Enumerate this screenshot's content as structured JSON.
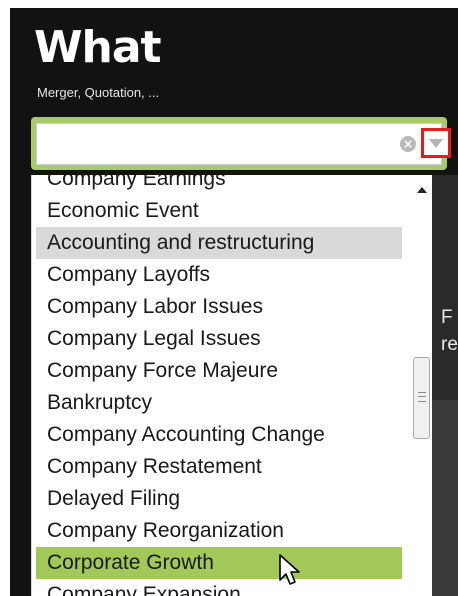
{
  "header": {
    "title": "What",
    "subtitle": "Merger, Quotation, ..."
  },
  "search": {
    "value": "",
    "placeholder": ""
  },
  "dropdown": {
    "items": [
      {
        "label": "Company Earnings"
      },
      {
        "label": "Economic Event"
      },
      {
        "label": "Accounting and restructuring",
        "state": "hover"
      },
      {
        "label": "Company Layoffs"
      },
      {
        "label": "Company Labor Issues"
      },
      {
        "label": "Company Legal Issues"
      },
      {
        "label": "Company Force Majeure"
      },
      {
        "label": "Bankruptcy"
      },
      {
        "label": "Company Accounting Change"
      },
      {
        "label": "Company Restatement"
      },
      {
        "label": "Delayed Filing"
      },
      {
        "label": "Company Reorganization"
      },
      {
        "label": "Corporate Growth",
        "state": "selected"
      },
      {
        "label": "Company Expansion"
      }
    ]
  },
  "background": {
    "partial_text": "F\nre"
  },
  "colors": {
    "header_bg": "#121212",
    "accent_green": "#a3c85a",
    "hover_gray": "#d9d9d9",
    "toggle_highlight": "#e41c1c"
  }
}
